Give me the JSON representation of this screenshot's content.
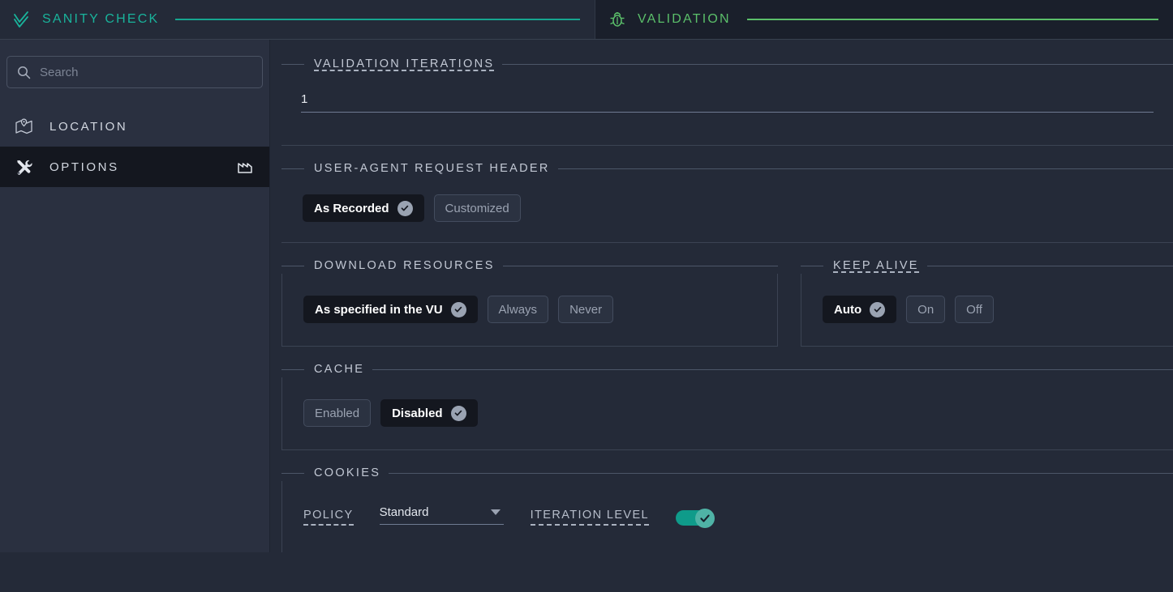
{
  "tabs": [
    {
      "id": "sanity-check",
      "label": "SANITY CHECK",
      "icon": "double-check-icon",
      "accent": "#16a58f",
      "active": false
    },
    {
      "id": "validation",
      "label": "VALIDATION",
      "icon": "bug-icon",
      "accent": "#5bbf6a",
      "active": true
    }
  ],
  "sidebar": {
    "search": {
      "placeholder": "Search",
      "value": "",
      "icon": "search-icon"
    },
    "items": [
      {
        "id": "location",
        "label": "LOCATION",
        "icon": "map-pin-icon",
        "selected": false,
        "trailing_icon": ""
      },
      {
        "id": "options",
        "label": "OPTIONS",
        "icon": "tools-icon",
        "selected": true,
        "trailing_icon": "factory-icon"
      }
    ],
    "collapse_handle": "collapse-left-icon"
  },
  "main": {
    "iterations": {
      "title": "VALIDATION ITERATIONS",
      "has_tooltip": true,
      "value": "1"
    },
    "user_agent": {
      "title": "USER-AGENT REQUEST HEADER",
      "has_tooltip": false,
      "options": [
        {
          "label": "As Recorded",
          "selected": true
        },
        {
          "label": "Customized",
          "selected": false
        }
      ]
    },
    "download_resources": {
      "title": "DOWNLOAD RESOURCES",
      "has_tooltip": false,
      "options": [
        {
          "label": "As specified in the VU",
          "selected": true
        },
        {
          "label": "Always",
          "selected": false
        },
        {
          "label": "Never",
          "selected": false
        }
      ]
    },
    "keep_alive": {
      "title": "KEEP ALIVE",
      "has_tooltip": true,
      "options": [
        {
          "label": "Auto",
          "selected": true
        },
        {
          "label": "On",
          "selected": false
        },
        {
          "label": "Off",
          "selected": false
        }
      ]
    },
    "cache": {
      "title": "CACHE",
      "has_tooltip": false,
      "options": [
        {
          "label": "Enabled",
          "selected": false
        },
        {
          "label": "Disabled",
          "selected": true
        }
      ]
    },
    "cookies": {
      "title": "COOKIES",
      "has_tooltip": false,
      "policy_label": "POLICY",
      "policy_value": "Standard",
      "policy_options": [
        "Standard"
      ],
      "iteration_level_label": "ITERATION LEVEL",
      "iteration_level_on": true
    }
  },
  "colors": {
    "sanity_accent": "#16a58f",
    "validation_accent": "#5bbf6a",
    "toggle_on": "#0f9b8a",
    "sidebar_bg": "#2a3040",
    "content_bg": "#242a38",
    "selected_bg": "#14171f"
  }
}
